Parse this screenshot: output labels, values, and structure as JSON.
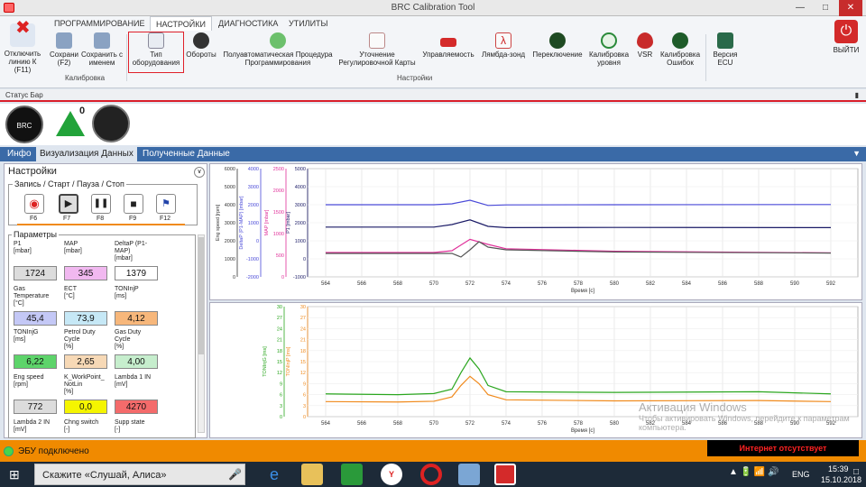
{
  "window": {
    "title": "BRC Calibration Tool"
  },
  "ribbon": {
    "disconnect": "Отключить линию К (F11)",
    "tabs": [
      "ПРОГРАММИРОВАНИЕ",
      "НАСТРОЙКИ",
      "ДИАГНОСТИКА",
      "УТИЛИТЫ"
    ],
    "active_tab": "НАСТРОЙКИ",
    "buttons": [
      {
        "label": "Сохрани (F2)",
        "icon": "save-icon"
      },
      {
        "label": "Сохранить с именем",
        "icon": "save-as-icon"
      },
      {
        "label": "Тип оборудования",
        "icon": "equipment-icon"
      },
      {
        "label": "Обороты",
        "icon": "rpm-icon"
      },
      {
        "label": "Полуавтоматическая Процедура Программирования",
        "icon": "auto-program-icon"
      },
      {
        "label": "Уточнение Регулировочной Карты",
        "icon": "map-refine-icon"
      },
      {
        "label": "Управляемость",
        "icon": "car-icon"
      },
      {
        "label": "Лямбда-зонд",
        "icon": "lambda-icon"
      },
      {
        "label": "Переключение",
        "icon": "switch-icon"
      },
      {
        "label": "Калибровка уровня",
        "icon": "level-icon"
      },
      {
        "label": "VSR",
        "icon": "vsr-icon"
      },
      {
        "label": "Калибровка Ошибок",
        "icon": "error-cal-icon"
      },
      {
        "label": "Версия ECU",
        "icon": "ecu-icon"
      }
    ],
    "groups": [
      "Калибровка",
      "Настройки"
    ],
    "exit": "ВЫЙТИ"
  },
  "status": {
    "label": "Статус Бар",
    "warning_count": "0"
  },
  "navtabs": [
    "Инфо",
    "Визуализация Данных",
    "Полученные Данные"
  ],
  "panel": {
    "title": "Настройки",
    "record_title": "Запись / Старт / Пауза / Стоп",
    "keys": [
      "F6",
      "F7",
      "F8",
      "F9",
      "F12"
    ],
    "params_title": "Параметры",
    "fields": [
      {
        "label": "P1\n[mbar]",
        "value": "1724",
        "color": "#dcdcdc"
      },
      {
        "label": "MAP\n[mbar]",
        "value": "345",
        "color": "#f1b8f0"
      },
      {
        "label": "DeltaP (P1-\nMAP)\n[mbar]",
        "value": "1379",
        "color": "#ffffff"
      },
      {
        "label": "Gas\nTemperature\n[°C]",
        "value": "45,4",
        "color": "#c4c8f6"
      },
      {
        "label": "ECT\n[°C]",
        "value": "73,9",
        "color": "#c6e8f6"
      },
      {
        "label": "TONInjP\n[ms]",
        "value": "4,12",
        "color": "#f7b77b"
      },
      {
        "label": "TONInjG\n[ms]",
        "value": "6,22",
        "color": "#5dd46a"
      },
      {
        "label": "Petrol Duty\nCycle\n[%]",
        "value": "2,65",
        "color": "#f7d9b6"
      },
      {
        "label": "Gas Duty\nCycle\n[%]",
        "value": "4,00",
        "color": "#c6eecd"
      },
      {
        "label": "Eng speed\n[rpm]",
        "value": "772",
        "color": "#dcdcdc"
      },
      {
        "label": "K_WorkPoint_\nNotLin\n[%]",
        "value": "0,0",
        "color": "#f5f500"
      },
      {
        "label": "Lambda 1 IN\n[mV]",
        "value": "4270",
        "color": "#f46b6b"
      },
      {
        "label": "Lambda 2 IN\n[mV]",
        "value": "",
        "color": "#ffffff"
      },
      {
        "label": "Chng switch\n[-]",
        "value": "",
        "color": "#ffffff"
      },
      {
        "label": "Supp state\n[-]",
        "value": "",
        "color": "#ffffff"
      }
    ]
  },
  "chart_data": [
    {
      "type": "line",
      "xlabel": "Время [с]",
      "xticks": [
        "564",
        "566",
        "568",
        "570",
        "572",
        "574",
        "576",
        "578",
        "580",
        "582",
        "584",
        "586",
        "588",
        "590",
        "592"
      ],
      "axes": [
        {
          "label": "Eng speed [rpm]",
          "ticks": [
            "0",
            "1000",
            "2000",
            "3000",
            "4000",
            "5000",
            "6000"
          ]
        },
        {
          "label": "DeltaP (P1-MAP) [mbar]",
          "ticks": [
            "-2000",
            "-1000",
            "0",
            "1000",
            "2000",
            "3000",
            "4000"
          ]
        },
        {
          "label": "MAP [mbar]",
          "ticks": [
            "0",
            "500",
            "1000",
            "1500",
            "2000",
            "2500"
          ]
        },
        {
          "label": "P1 [mbar]",
          "ticks": [
            "-1000",
            "0",
            "1000",
            "2000",
            "3000",
            "4000",
            "5000"
          ]
        }
      ],
      "series": [
        {
          "color": "#4a4ad8",
          "x": [
            564,
            570,
            571,
            572,
            573,
            574,
            580,
            592
          ],
          "y": [
            3000,
            3000,
            3050,
            3250,
            2960,
            2990,
            3000,
            3010
          ],
          "axis": "P1"
        },
        {
          "color": "#1a1a66",
          "x": [
            564,
            570,
            571,
            572,
            573,
            574,
            580,
            592
          ],
          "y": [
            1760,
            1760,
            1900,
            2160,
            1800,
            1730,
            1740,
            1730
          ],
          "axis": "P1"
        },
        {
          "color": "#e0309a",
          "x": [
            564,
            570,
            571,
            572,
            573,
            574,
            580,
            592
          ],
          "y": [
            350,
            350,
            450,
            1080,
            800,
            560,
            420,
            330
          ],
          "axis": "P1"
        },
        {
          "color": "#555555",
          "x": [
            564,
            571,
            571.5,
            572,
            572.5,
            573,
            574,
            580,
            592
          ],
          "y": [
            300,
            300,
            100,
            500,
            950,
            650,
            500,
            380,
            320
          ],
          "axis": "P1"
        }
      ]
    },
    {
      "type": "line",
      "xlabel": "Время [с]",
      "xticks": [
        "564",
        "566",
        "568",
        "570",
        "572",
        "574",
        "576",
        "578",
        "580",
        "582",
        "584",
        "586",
        "588",
        "590",
        "592"
      ],
      "axes": [
        {
          "label": "TONInjG [ms]",
          "ticks": [
            "0",
            "3",
            "6",
            "9",
            "12",
            "15",
            "18",
            "21",
            "24",
            "27",
            "30"
          ]
        },
        {
          "label": "TONInjP [ms]",
          "ticks": [
            "0",
            "3",
            "6",
            "9",
            "12",
            "15",
            "18",
            "21",
            "24",
            "27",
            "30"
          ]
        }
      ],
      "series": [
        {
          "name": "TONInjG",
          "color": "#2aa61e",
          "x": [
            564,
            568,
            570,
            571,
            571.5,
            572,
            572.5,
            573,
            574,
            580,
            588,
            592
          ],
          "y": [
            6.2,
            6.0,
            6.3,
            7.5,
            12,
            16,
            13,
            8.5,
            6.8,
            6.6,
            6.8,
            6.2
          ]
        },
        {
          "name": "TONInjP",
          "color": "#f08a1c",
          "x": [
            564,
            568,
            570,
            571,
            571.5,
            572,
            572.5,
            573,
            574,
            580,
            588,
            592
          ],
          "y": [
            4.1,
            4.0,
            4.2,
            5.4,
            8.5,
            11,
            9,
            6,
            4.6,
            4.3,
            4.4,
            4.1
          ]
        }
      ]
    }
  ],
  "footer": {
    "connection": "ЭБУ подключено",
    "internet": "Интернет отсутствует",
    "watermark1": "Активация Windows",
    "watermark2": "Чтобы активировать Windows, перейдите к параметрам компьютера."
  },
  "taskbar": {
    "search": "Скажите «Слушай, Алиса»",
    "lang": "ENG",
    "time": "15:39",
    "date": "15.10.2018"
  }
}
